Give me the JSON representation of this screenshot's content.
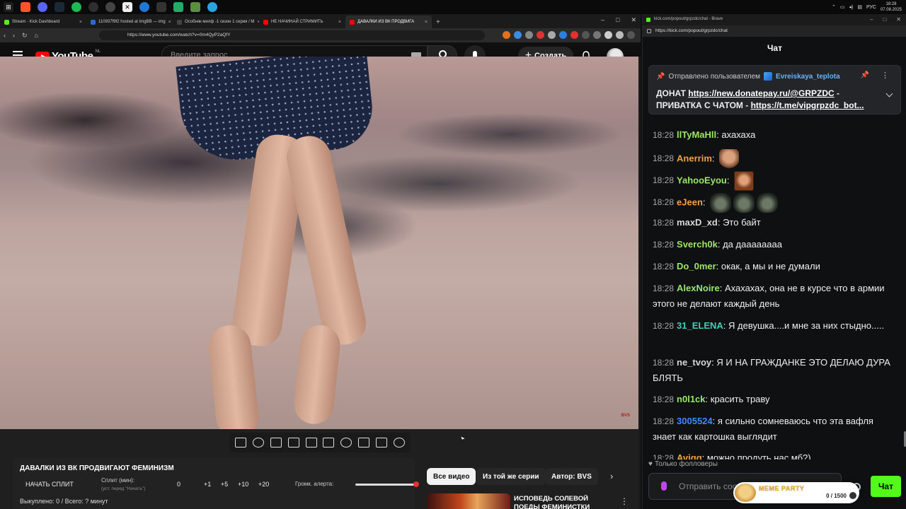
{
  "taskbar": {
    "lang": "РУС",
    "time": "18:28",
    "date": "07.08.2025"
  },
  "browser": {
    "tabs": [
      {
        "label": "Stream - Kick Dashboard",
        "color": "#53fc18"
      },
      {
        "label": "110937f9f2 hosted at ImgBB — img",
        "color": "#2a6ad4"
      },
      {
        "label": "Особняк милф -1 сезон 1 серия / М",
        "color": "#444"
      },
      {
        "label": "НЕ НАЧИНАЙ СТРИМИТЬ",
        "color": "#ff0000"
      },
      {
        "label": "ДАВАЛКИ ИЗ ВК ПРОДВИГА",
        "color": "#ff0000"
      }
    ],
    "url": "https://www.youtube.com/watch?v=0m4QyP2aQfY"
  },
  "youtube": {
    "logo_text": "YouTube",
    "region": "NL",
    "search_placeholder": "Введите запрос",
    "create_label": "Создать",
    "video_watermark": "BVS"
  },
  "split": {
    "title": "ДАВАЛКИ ИЗ ВК ПРОДВИГАЮТ ФЕМИНИЗМ",
    "start_label": "НАЧАТЬ СПЛИТ",
    "minutes_label": "Сплит (мин):",
    "minutes_hint": "(уст. перед \"Начать\")",
    "value": "0",
    "increments": [
      "+1",
      "+5",
      "+10",
      "+20"
    ],
    "volume_label": "Громк. алерта:",
    "volume_level": 0.98,
    "bought_text": "Выкуплено: 0 / Всего: ? минут"
  },
  "chips": [
    "Все видео",
    "Из той же серии",
    "Автор: BVS"
  ],
  "recommendation": {
    "title": "ИСПОВЕДЬ СОЛЕВОЙ ПОЕДЫ ФЕМИНИСТКИ"
  },
  "kick": {
    "window_title": "kick.com/popout/grpzdc/chat - Brave",
    "url": "https://kick.com/popout/grpzdc/chat",
    "header": "Чат",
    "pinned": {
      "sent_by": "Отправлено пользователем",
      "user": "Evreiskaya_teplota",
      "line1_prefix": "ДОНАТ ",
      "line1_link": "https://new.donatepay.ru/@GRPZDC",
      "line1_suffix": " -",
      "line2_prefix": "ПРИВАТКА С ЧАТОМ - ",
      "line2_link": "https://t.me/vipgrpzdc_bot..."
    },
    "messages": [
      {
        "time": "18:28",
        "user": "llTyMaHll",
        "color": "#9be66a",
        "text": "ахахаха"
      },
      {
        "time": "18:28",
        "user": "Anerrim",
        "color": "#f5a23c",
        "text": ""
      },
      {
        "time": "18:28",
        "user": "YahooEyou",
        "color": "#9be66a",
        "text": ""
      },
      {
        "time": "18:28",
        "user": "eJeen",
        "color": "#f5a23c",
        "text": ""
      },
      {
        "time": "18:28",
        "user": "maxD_xd",
        "color": "#d8d8d8",
        "text": "Это байт"
      },
      {
        "time": "18:28",
        "user": "Sverch0k",
        "color": "#9be66a",
        "text": "да даааааааа"
      },
      {
        "time": "18:28",
        "user": "Do_0mer",
        "color": "#9be66a",
        "text": "окак, а мы и не думали"
      },
      {
        "time": "18:28",
        "user": "AlexNoire",
        "color": "#9be66a",
        "text": "Ахахахах, она не в курсе что в армии этого не делают каждый день"
      },
      {
        "time": "18:28",
        "user": "31_ELENA",
        "color": "#3fd0b5",
        "text": "Я девушка....и мне за них стыдно....."
      },
      {
        "time": "18:28",
        "user": "ne_tvoy",
        "color": "#d8d8d8",
        "text": "Я И НА ГРАЖДАНКЕ ЭТО ДЕЛАЮ ДУРА БЛЯТЬ"
      },
      {
        "time": "18:28",
        "user": "n0l1ck",
        "color": "#9be66a",
        "text": "красить траву"
      },
      {
        "time": "18:28",
        "user": "3005524",
        "color": "#3b8dff",
        "text": "я сильно сомневаюсь что эта вафля знает как картошка выглядит"
      },
      {
        "time": "18:28",
        "user": "Aviqq",
        "color": "#f5a23c",
        "text": "можно продуть нас мб?)"
      }
    ],
    "followers_only": "Только фолловеры",
    "input_placeholder": "Отправить сообщение",
    "send_label": "Чат",
    "meme_party": {
      "title": "MEME PARTY",
      "progress": "0 / 1500"
    }
  }
}
